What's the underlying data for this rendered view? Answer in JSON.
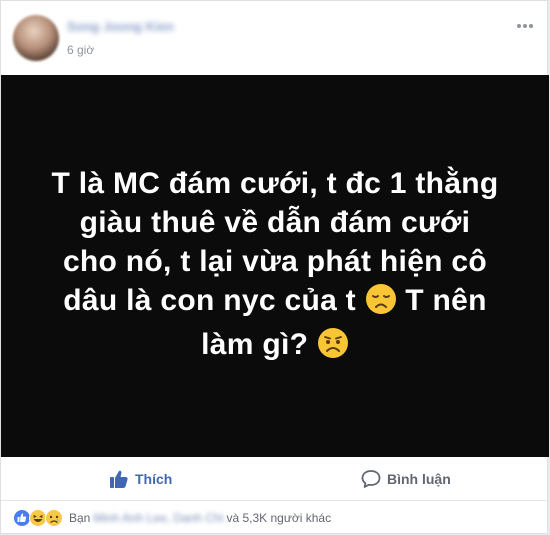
{
  "post": {
    "author_name": "Song Joong Kien",
    "time": "6 giờ",
    "more_icon": "ellipsis-icon",
    "image_text": {
      "line1": "T là MC đám cưới, t đc 1 thằng",
      "line2": "giàu thuê về dẫn đám cưới",
      "line3": "cho nó, t lại vừa phát hiện cô",
      "line4_a": "dâu là con nyc của t",
      "line4_b": "T nên",
      "line5": "làm gì?",
      "emoji1": "disappointed-face",
      "emoji2": "worried-face"
    },
    "image_background": "#0b0b0b"
  },
  "actions": {
    "like_label": "Thích",
    "comment_label": "Bình luận",
    "accent": "#4267b2"
  },
  "reactions": {
    "icons": [
      "like-reaction-icon",
      "haha-reaction-icon",
      "sad-reaction-icon"
    ],
    "prefix": "Bạn",
    "names": "Minh Anh Lee, Danh Chi",
    "suffix": "và 5,3K người khác"
  }
}
